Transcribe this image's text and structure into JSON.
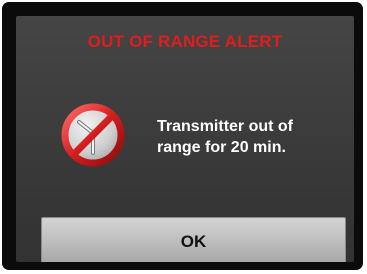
{
  "alert": {
    "title": "OUT OF RANGE ALERT",
    "icon": "no-signal-icon",
    "message_line1": "Transmitter out of",
    "message_line2": "range for 20 min.",
    "button_label": "OK"
  },
  "colors": {
    "title": "#e11c1c",
    "screen_background": "#3f3f3f",
    "frame": "#0b0b0b",
    "button": "#c4c4c4",
    "icon_ring": "#d32020",
    "icon_symbol": "#e6e6e6"
  }
}
